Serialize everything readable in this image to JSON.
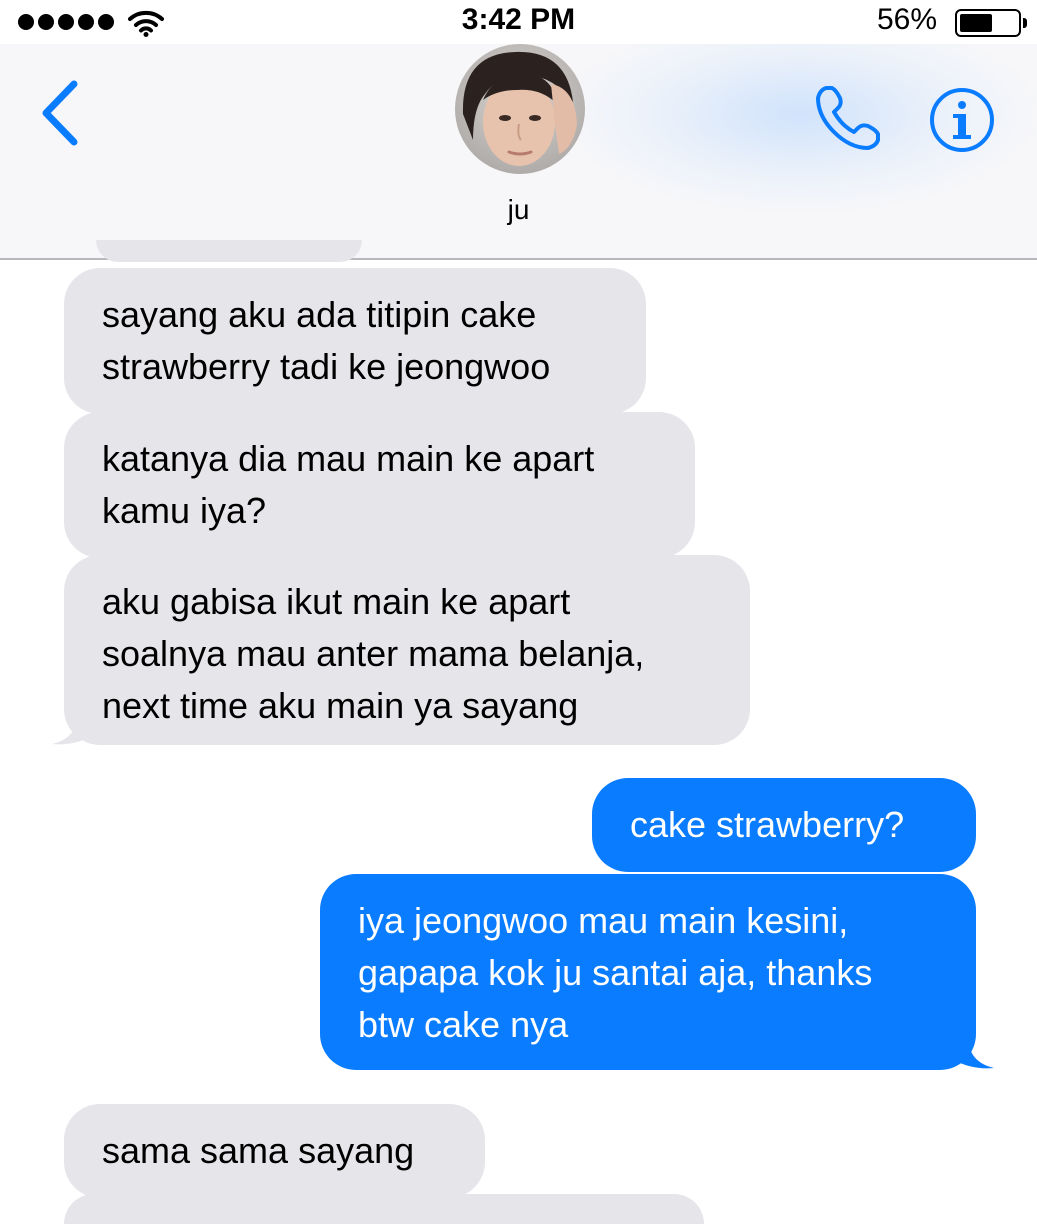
{
  "status_bar": {
    "time": "3:42 PM",
    "battery_percent": "56%",
    "battery_level": 0.56,
    "signal_dots": 5
  },
  "header": {
    "contact_name": "ju",
    "icons": {
      "back": "chevron-left-icon",
      "call": "phone-icon",
      "info": "info-icon"
    }
  },
  "colors": {
    "accent": "#0a7cff",
    "incoming_bubble": "#e5e5ea",
    "outgoing_text": "#ffffff"
  },
  "messages": [
    {
      "direction": "incoming",
      "text": "sayang aku ada titipin cake\nstrawberry tadi ke jeongwoo"
    },
    {
      "direction": "incoming",
      "text": "katanya dia mau main ke apart\nkamu iya?"
    },
    {
      "direction": "incoming",
      "text": "aku gabisa ikut main ke apart\nsoalnya mau anter mama belanja,\nnext time aku main ya sayang"
    },
    {
      "direction": "outgoing",
      "text": "cake strawberry?"
    },
    {
      "direction": "outgoing",
      "text": "iya jeongwoo mau main kesini,\ngapapa kok ju santai aja, thanks\nbtw cake nya"
    },
    {
      "direction": "incoming",
      "text": "sama sama sayang"
    }
  ]
}
